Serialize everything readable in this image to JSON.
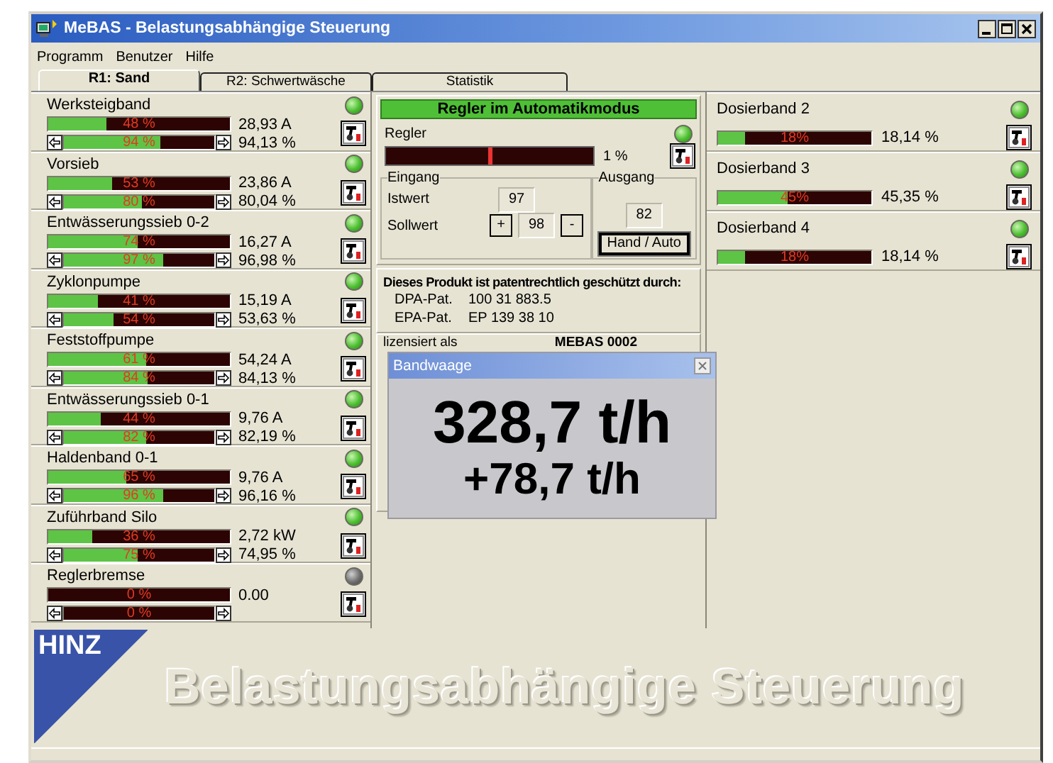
{
  "window": {
    "title": "MeBAS - Belastungsabhängige Steuerung"
  },
  "menu": [
    "Programm",
    "Benutzer",
    "Hilfe"
  ],
  "tabs": [
    {
      "label": "R1: Sand",
      "selected": true
    },
    {
      "label": "R2: Schwertwäsche",
      "selected": false
    },
    {
      "label": "Statistik",
      "selected": false
    }
  ],
  "drives": [
    {
      "name": "Werksteigband",
      "on": true,
      "current": {
        "level": 0.32,
        "label": "48 %"
      },
      "current_value": "28,93 A",
      "speed": {
        "level": 0.64,
        "label": "94 %"
      },
      "speed_value": "94,13 %"
    },
    {
      "name": "Vorsieb",
      "on": true,
      "current": {
        "level": 0.35,
        "label": "53 %"
      },
      "current_value": "23,86 A",
      "speed": {
        "level": 0.52,
        "label": "80 %"
      },
      "speed_value": "80,04 %"
    },
    {
      "name": "Entwässerungssieb 0-2",
      "on": true,
      "current": {
        "level": 0.49,
        "label": "74 %"
      },
      "current_value": "16,27 A",
      "speed": {
        "level": 0.66,
        "label": "97 %"
      },
      "speed_value": "96,98 %"
    },
    {
      "name": "Zyklonpumpe",
      "on": true,
      "current": {
        "level": 0.27,
        "label": "41 %"
      },
      "current_value": "15,19 A",
      "speed": {
        "level": 0.33,
        "label": "54 %"
      },
      "speed_value": "53,63 %"
    },
    {
      "name": "Feststoffpumpe",
      "on": true,
      "current": {
        "level": 0.54,
        "label": "61 %"
      },
      "current_value": "54,24 A",
      "speed": {
        "level": 0.56,
        "label": "84 %"
      },
      "speed_value": "84,13 %"
    },
    {
      "name": "Entwässerungssieb 0-1",
      "on": true,
      "current": {
        "level": 0.29,
        "label": "44 %"
      },
      "current_value": "9,76 A",
      "speed": {
        "level": 0.55,
        "label": "82 %"
      },
      "speed_value": "82,19 %"
    },
    {
      "name": "Haldenband 0-1",
      "on": true,
      "current": {
        "level": 0.43,
        "label": "65 %"
      },
      "current_value": "9,76 A",
      "speed": {
        "level": 0.66,
        "label": "96 %"
      },
      "speed_value": "96,16 %"
    },
    {
      "name": "Zuführband Silo",
      "on": true,
      "current": {
        "level": 0.24,
        "label": "36 %"
      },
      "current_value": "2,72 kW",
      "speed": {
        "level": 0.49,
        "label": "75 %"
      },
      "speed_value": "74,95 %"
    },
    {
      "name": "Reglerbremse",
      "on": false,
      "current": {
        "level": 0,
        "label": "0 %"
      },
      "current_value": "0.00",
      "speed": {
        "level": 0,
        "label": "0 %"
      }
    }
  ],
  "controller": {
    "header": "Regler im Automatikmodus",
    "label": "Regler",
    "on": true,
    "level": 0.5,
    "reading": "1 %",
    "input": {
      "title": "Eingang",
      "actual_label": "Istwert",
      "actual_value": "97",
      "setpoint_label": "Sollwert",
      "increase": "+",
      "setpoint_value": "98",
      "decrease": "-"
    },
    "output": {
      "title": "Ausgang",
      "value": "82",
      "button": "Hand / Auto"
    }
  },
  "patent": {
    "heading": "Dieses Produkt ist patentrechtlich geschützt durch:",
    "entries": [
      {
        "label": "DPA-Pat.",
        "number": "100 31 883.5"
      },
      {
        "label": "EPA-Pat.",
        "number": "EP 139 38 10"
      }
    ]
  },
  "license": {
    "label": "lizensiert als",
    "value": "MEBAS 0002"
  },
  "dosing": [
    {
      "name": "Dosierband 2",
      "on": true,
      "level": 0.18,
      "label": "18%",
      "value": "18,14 %"
    },
    {
      "name": "Dosierband 3",
      "on": true,
      "level": 0.45,
      "label": "45%",
      "value": "45,35 %"
    },
    {
      "name": "Dosierband 4",
      "on": true,
      "level": 0.18,
      "label": "18%",
      "value": "18,14 %"
    }
  ],
  "popup": {
    "title": "Bandwaage",
    "main": "328,7 t/h",
    "delta": "+78,7 t/h"
  },
  "logo": "HINZ",
  "banner": "Belastungsabhängige Steuerung"
}
